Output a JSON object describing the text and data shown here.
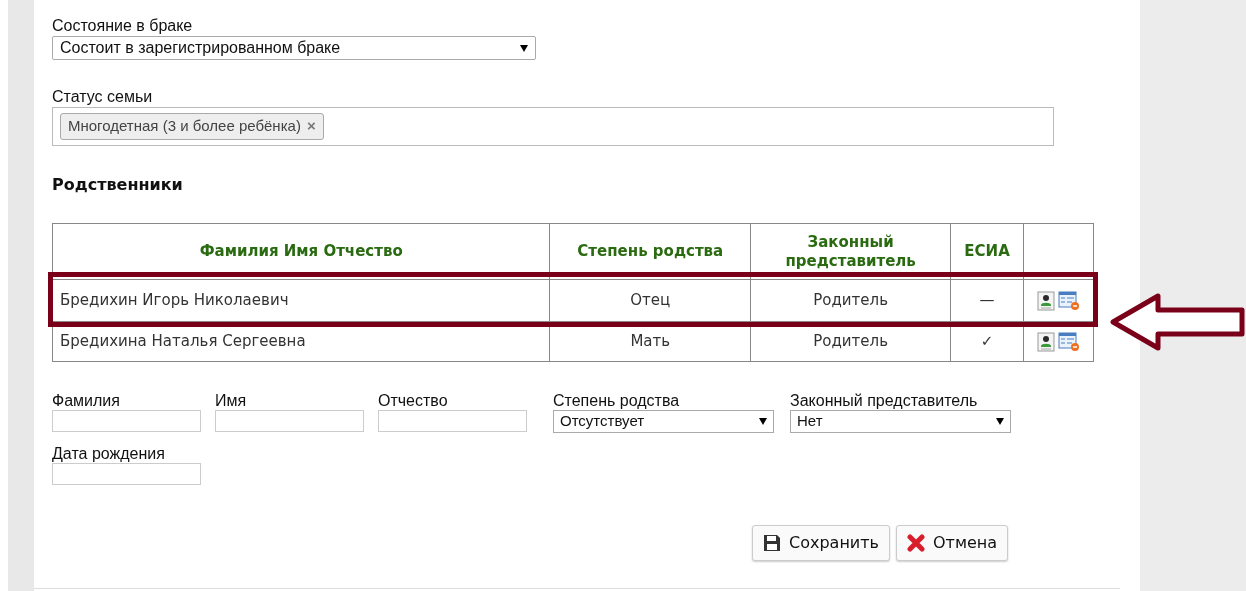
{
  "marital_status": {
    "label": "Состояние в браке",
    "value": "Состоит в зарегистрированном браке"
  },
  "family_status": {
    "label": "Статус семьи",
    "tags": [
      {
        "label": "Многодетная (3 и более ребёнка)",
        "remove": "×"
      }
    ]
  },
  "relatives": {
    "title": "Родственники",
    "columns": [
      "Фамилия Имя Отчество",
      "Степень родства",
      "Законный представитель",
      "ЕСИА"
    ],
    "rows": [
      {
        "name": "Бредихин Игорь Николаевич",
        "relation": "Отец",
        "representative": "Родитель",
        "esia": "—",
        "highlighted": true
      },
      {
        "name": "Бредихина Наталья Сергеевна",
        "relation": "Мать",
        "representative": "Родитель",
        "esia": "✓",
        "highlighted": false
      }
    ]
  },
  "new_relative": {
    "fields": [
      {
        "kind": "text",
        "label": "Фамилия"
      },
      {
        "kind": "text",
        "label": "Имя"
      },
      {
        "kind": "text",
        "label": "Отчество"
      },
      {
        "kind": "select",
        "label": "Степень родства",
        "value": "Отсутствует"
      },
      {
        "kind": "select",
        "label": "Законный представитель",
        "value": "Нет"
      },
      {
        "kind": "text",
        "label": "Дата рождения"
      }
    ]
  },
  "buttons": [
    {
      "kind": "save",
      "label": "Сохранить"
    },
    {
      "kind": "cancel",
      "label": "Отмена"
    }
  ]
}
